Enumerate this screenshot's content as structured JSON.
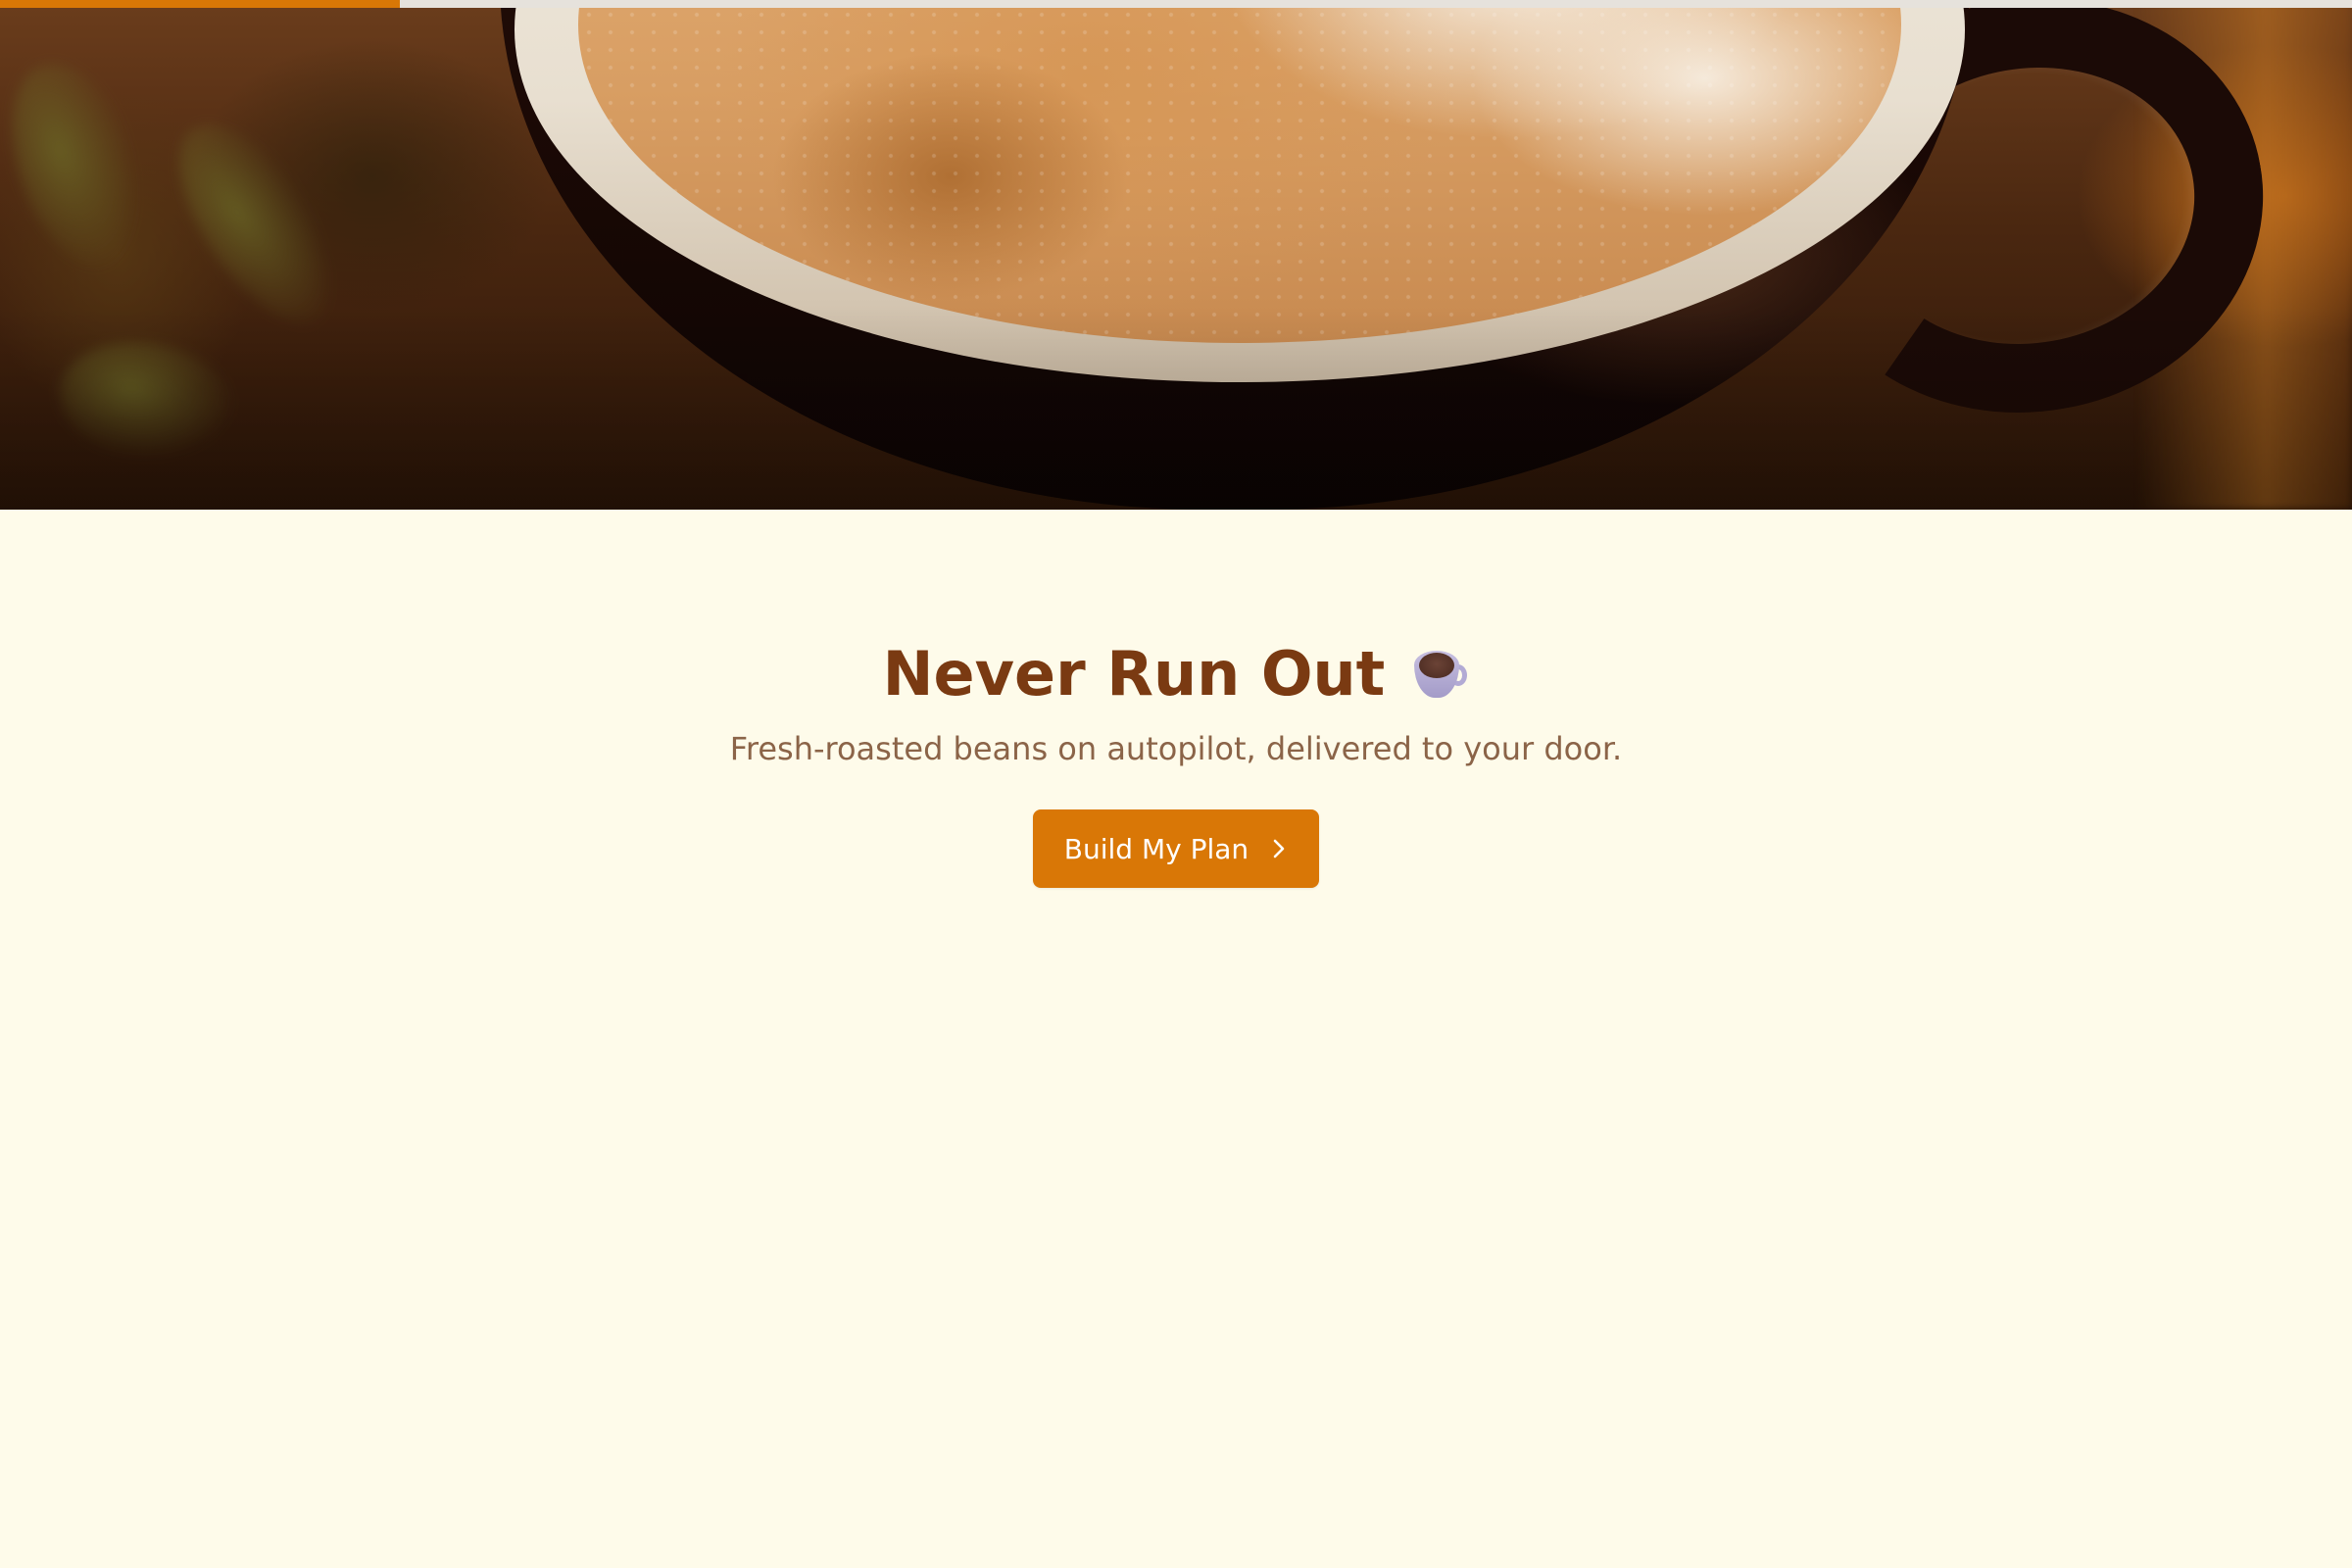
{
  "progress": {
    "value_percent": 17,
    "fill_color": "#d97706",
    "track_color": "#e6e2dc"
  },
  "hero": {
    "image_subject": "latte-cup-photo"
  },
  "headline": {
    "text": "Never Run Out",
    "icon": "coffee-cup-icon"
  },
  "subtitle": {
    "text": "Fresh-roasted beans on autopilot, delivered to your door."
  },
  "cta": {
    "label": "Build My Plan",
    "icon": "chevron-right-icon",
    "color": "#d97706"
  },
  "colors": {
    "background": "#fefbea",
    "headline": "#7a3a12",
    "subtitle": "#8b6448"
  }
}
